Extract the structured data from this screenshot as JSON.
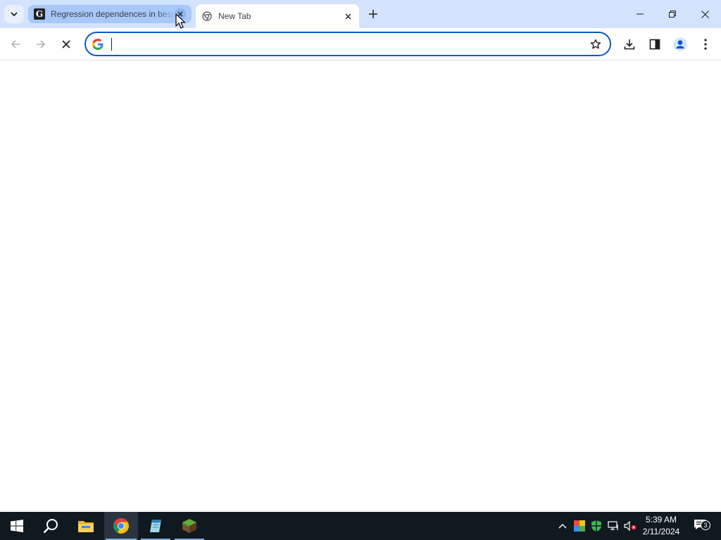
{
  "browser": {
    "tabs": [
      {
        "title": "Regression dependences in best",
        "favicon": "g-letter-icon",
        "active": false
      },
      {
        "title": "New Tab",
        "favicon": "chrome-icon",
        "active": true
      }
    ],
    "omnibox": {
      "value": "",
      "placeholder": ""
    },
    "colors": {
      "accent": "#0b57d0",
      "tabstrip": "#d3e3fd",
      "inactive_tab": "#a8c7fa"
    }
  },
  "taskbar": {
    "apps": [
      "windows-start-icon",
      "search-icon",
      "file-explorer-icon",
      "chrome-icon",
      "notepad-icon",
      "minecraft-icon"
    ],
    "clock": {
      "time": "5:39 AM",
      "date": "2/11/2024"
    },
    "notifications_count": "3"
  }
}
